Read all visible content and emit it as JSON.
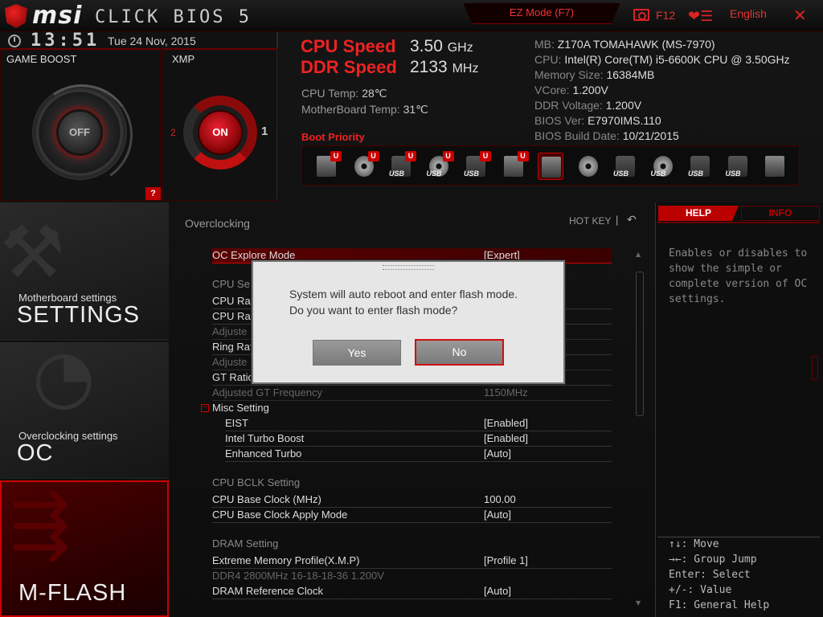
{
  "header": {
    "brand": "msi",
    "product": "CLICK BIOS 5",
    "ez_mode": "EZ Mode (F7)",
    "screenshot_key": "F12",
    "language": "English",
    "close": "✕",
    "favorites_icon": "heart-menu-icon"
  },
  "status": {
    "time": "13:51",
    "date": "Tue  24 Nov, 2015",
    "game_boost_label": "GAME BOOST",
    "game_boost_state": "OFF",
    "xmp_label": "XMP",
    "xmp_state": "ON",
    "xmp_left": "2",
    "xmp_right": "1",
    "help_mark": "?"
  },
  "speeds": {
    "cpu_label": "CPU Speed",
    "cpu_value": "3.50",
    "cpu_unit": "GHz",
    "ddr_label": "DDR Speed",
    "ddr_value": "2133",
    "ddr_unit": "MHz",
    "cpu_temp_label": "CPU Temp:",
    "cpu_temp": "28℃",
    "mb_temp_label": "MotherBoard Temp:",
    "mb_temp": "31℃"
  },
  "sysinfo": [
    {
      "k": "MB:",
      "v": "Z170A TOMAHAWK (MS-7970)"
    },
    {
      "k": "CPU:",
      "v": "Intel(R) Core(TM) i5-6600K CPU @ 3.50GHz"
    },
    {
      "k": "Memory Size:",
      "v": "16384MB"
    },
    {
      "k": "VCore:",
      "v": "1.200V"
    },
    {
      "k": "DDR Voltage:",
      "v": "1.200V"
    },
    {
      "k": "BIOS Ver:",
      "v": "E7970IMS.110"
    },
    {
      "k": "BIOS Build Date:",
      "v": "10/21/2015"
    }
  ],
  "boot": {
    "label": "Boot Priority",
    "devices": [
      {
        "name": "hdd",
        "u": "U",
        "tag": ""
      },
      {
        "name": "optical",
        "u": "U",
        "tag": ""
      },
      {
        "name": "usb-hdd",
        "u": "U",
        "tag": "USB"
      },
      {
        "name": "usb-optical",
        "u": "U",
        "tag": "USB"
      },
      {
        "name": "usb-key",
        "u": "U",
        "tag": "USB"
      },
      {
        "name": "floppy",
        "u": "U",
        "tag": ""
      },
      {
        "name": "hdd-selected",
        "u": "",
        "tag": ""
      },
      {
        "name": "optical",
        "u": "",
        "tag": ""
      },
      {
        "name": "usb-hdd",
        "u": "",
        "tag": "USB"
      },
      {
        "name": "usb-optical",
        "u": "",
        "tag": "USB"
      },
      {
        "name": "usb-key",
        "u": "",
        "tag": "USB"
      },
      {
        "name": "usb-floppy",
        "u": "",
        "tag": "USB"
      },
      {
        "name": "network",
        "u": "",
        "tag": ""
      }
    ]
  },
  "nav": {
    "settings_small": "Motherboard settings",
    "settings_big": "SETTINGS",
    "oc_small": "Overclocking settings",
    "oc_big": "OC",
    "mflash_big": "M-FLASH"
  },
  "main": {
    "title": "Overclocking",
    "hotkey": "HOT KEY",
    "hotkey_sep": "|",
    "rows": {
      "oc_explore": {
        "label": "OC Explore Mode",
        "value": "[Expert]"
      },
      "cpu_section": "CPU Se",
      "cpu_rat1": "CPU Rat",
      "cpu_rat2": "CPU Rat",
      "adjusted1": "Adjuste",
      "ring_rat": "Ring Rat",
      "adjusted2": "Adjuste",
      "gt_ratio": "GT Ratio",
      "adj_gt": {
        "label": "Adjusted GT Frequency",
        "value": "1150MHz"
      },
      "misc": "Misc Setting",
      "eist": {
        "label": "EIST",
        "value": "[Enabled]"
      },
      "turbo": {
        "label": "Intel Turbo Boost",
        "value": "[Enabled]"
      },
      "enh_turbo": {
        "label": "Enhanced Turbo",
        "value": "[Auto]"
      },
      "bclk_section": "CPU BCLK  Setting",
      "bclk": {
        "label": "CPU Base Clock (MHz)",
        "value": "100.00"
      },
      "bclk_mode": {
        "label": "CPU Base Clock Apply Mode",
        "value": "[Auto]"
      },
      "dram_section": "DRAM  Setting",
      "xmp": {
        "label": "Extreme Memory Profile(X.M.P)",
        "value": "[Profile 1]"
      },
      "ddr4": "DDR4 2800MHz 16-18-18-36 1.200V",
      "dram_ref": {
        "label": "DRAM Reference Clock",
        "value": "[Auto]"
      }
    }
  },
  "help": {
    "tab_help": "HELP",
    "tab_info": "INFO",
    "text": "Enables or disables to show the simple or complete version of OC settings.",
    "keys": [
      "↑↓: Move",
      "→←: Group Jump",
      "Enter: Select",
      "+/-: Value",
      "F1: General Help"
    ]
  },
  "dialog": {
    "line1": "System will auto reboot and enter flash mode.",
    "line2": "Do you want to enter flash mode?",
    "yes": "Yes",
    "no": "No"
  },
  "colors": {
    "accent": "#d01010",
    "panel": "#111111",
    "dialog": "#e6e6e6"
  }
}
